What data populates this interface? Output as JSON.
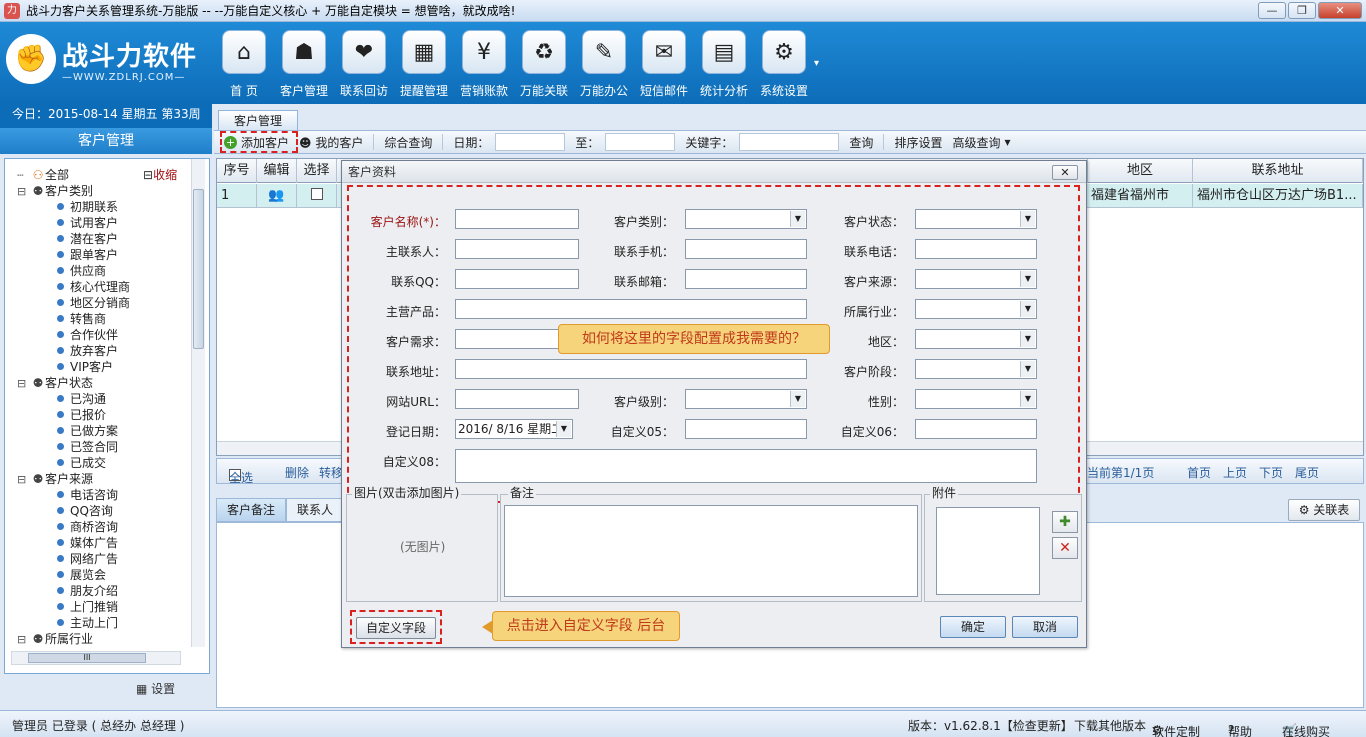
{
  "window": {
    "title": "战斗力客户关系管理系统-万能版 -- --万能自定义核心 + 万能自定模块 = 想管啥，就改成啥!",
    "controls": [
      "—",
      "❐",
      "✕"
    ]
  },
  "brand": {
    "name": "战斗力软件",
    "url": "—WWW.ZDLRJ.COM—",
    "date_line": "今日：2015-08-14  星期五  第33周"
  },
  "toolbar": [
    {
      "label": "首 页",
      "icon": "home-icon",
      "glyph": "⌂"
    },
    {
      "label": "客户管理",
      "icon": "customer-icon",
      "glyph": "☗"
    },
    {
      "label": "联系回访",
      "icon": "heart-icon",
      "glyph": "❤"
    },
    {
      "label": "提醒管理",
      "icon": "calendar-icon",
      "glyph": "▦"
    },
    {
      "label": "营销账款",
      "icon": "yen-icon",
      "glyph": "¥"
    },
    {
      "label": "万能关联",
      "icon": "recycle-icon",
      "glyph": "♻"
    },
    {
      "label": "万能办公",
      "icon": "checklist-icon",
      "glyph": "✎"
    },
    {
      "label": "短信邮件",
      "icon": "mail-icon",
      "glyph": "✉"
    },
    {
      "label": "统计分析",
      "icon": "chart-icon",
      "glyph": "▤"
    },
    {
      "label": "系统设置",
      "icon": "gear-icon",
      "glyph": "⚙"
    }
  ],
  "left_panel": {
    "title": "客户管理",
    "collapse_label": "收缩",
    "tree": [
      {
        "level": 0,
        "label": "全部",
        "icon": "all-icon"
      },
      {
        "level": 0,
        "label": "客户类别",
        "icon": "group-icon"
      },
      {
        "level": 1,
        "label": "初期联系"
      },
      {
        "level": 1,
        "label": "试用客户"
      },
      {
        "level": 1,
        "label": "潜在客户"
      },
      {
        "level": 1,
        "label": "跟单客户"
      },
      {
        "level": 1,
        "label": "供应商"
      },
      {
        "level": 1,
        "label": "核心代理商"
      },
      {
        "level": 1,
        "label": "地区分销商"
      },
      {
        "level": 1,
        "label": "转售商"
      },
      {
        "level": 1,
        "label": "合作伙伴"
      },
      {
        "level": 1,
        "label": "放弃客户"
      },
      {
        "level": 1,
        "label": "VIP客户"
      },
      {
        "level": 0,
        "label": "客户状态",
        "icon": "group-icon"
      },
      {
        "level": 1,
        "label": "已沟通"
      },
      {
        "level": 1,
        "label": "已报价"
      },
      {
        "level": 1,
        "label": "已做方案"
      },
      {
        "level": 1,
        "label": "已签合同"
      },
      {
        "level": 1,
        "label": "已成交"
      },
      {
        "level": 0,
        "label": "客户来源",
        "icon": "group-icon"
      },
      {
        "level": 1,
        "label": "电话咨询"
      },
      {
        "level": 1,
        "label": "QQ咨询"
      },
      {
        "level": 1,
        "label": "商桥咨询"
      },
      {
        "level": 1,
        "label": "媒体广告"
      },
      {
        "level": 1,
        "label": "网络广告"
      },
      {
        "level": 1,
        "label": "展览会"
      },
      {
        "level": 1,
        "label": "朋友介绍"
      },
      {
        "level": 1,
        "label": "上门推销"
      },
      {
        "level": 1,
        "label": "主动上门"
      },
      {
        "level": 0,
        "label": "所属行业",
        "icon": "group-icon"
      }
    ],
    "scroll_thumb_text": "III",
    "settings_label": "设置"
  },
  "main": {
    "tab": "客户管理",
    "subbar": {
      "add": "添加客户",
      "mine": "我的客户",
      "query": "综合查询",
      "date": "日期：",
      "to": "至：",
      "keyword": "关键字：",
      "search": "查询",
      "sort": "排序设置",
      "advanced": "高级查询",
      "advanced_arrow": "▾"
    },
    "grid": {
      "columns": [
        "序号",
        "编辑",
        "选择"
      ],
      "columns_right": [
        "地区",
        "联系地址"
      ],
      "row": {
        "index": "1",
        "region": "福建省福州市",
        "address": "福州市仓山区万达广场B1..."
      }
    },
    "pager": {
      "select_all": "全选",
      "delete": "删除",
      "transfer": "转移",
      "current": "当前第1/1页",
      "first": "首页",
      "prev": "上页",
      "next": "下页",
      "last": "尾页"
    },
    "bottom_tabs": [
      "客户备注",
      "联系人"
    ],
    "relation_button": "关联表"
  },
  "dialog": {
    "title": "客户资料",
    "close": "✕",
    "fields": {
      "name": "客户名称(*)：",
      "category": "客户类别：",
      "status": "客户状态：",
      "contact": "主联系人：",
      "mobile": "联系手机：",
      "phone": "联系电话：",
      "qq": "联系QQ：",
      "email": "联系邮箱：",
      "source": "客户来源：",
      "product": "主营产品：",
      "industry": "所属行业：",
      "demand": "客户需求：",
      "region": "地区：",
      "address": "联系地址：",
      "stage": "客户阶段：",
      "website": "网站URL：",
      "level": "客户级别：",
      "gender": "性别：",
      "regdate": "登记日期：",
      "regdate_value": "2016/ 8/16 星期二",
      "custom05": "自定义05：",
      "custom06": "自定义06：",
      "custom08": "自定义08："
    },
    "callout_fields": "如何将这里的字段配置成我需要的？",
    "picture_section": "图片(双击添加图片)",
    "no_picture": "(无图片)",
    "note_section": "备注",
    "attachment_section": "附件",
    "custom_field_button": "自定义字段",
    "callout_custom": "点击进入自定义字段 后台",
    "ok": "确定",
    "cancel": "取消"
  },
  "status": {
    "user": "管理员 已登录 ( 总经办 总经理 )",
    "version": "版本：v1.62.8.1【检查更新】",
    "download": "下载其他版本",
    "custom": "软件定制",
    "help": "帮助",
    "buy": "在线购买"
  },
  "colors": {
    "header_blue": "#0d6cb8",
    "highlight_red": "#d9221f",
    "callout_yellow": "#f6d47c",
    "selected_row": "#d4eff0"
  }
}
